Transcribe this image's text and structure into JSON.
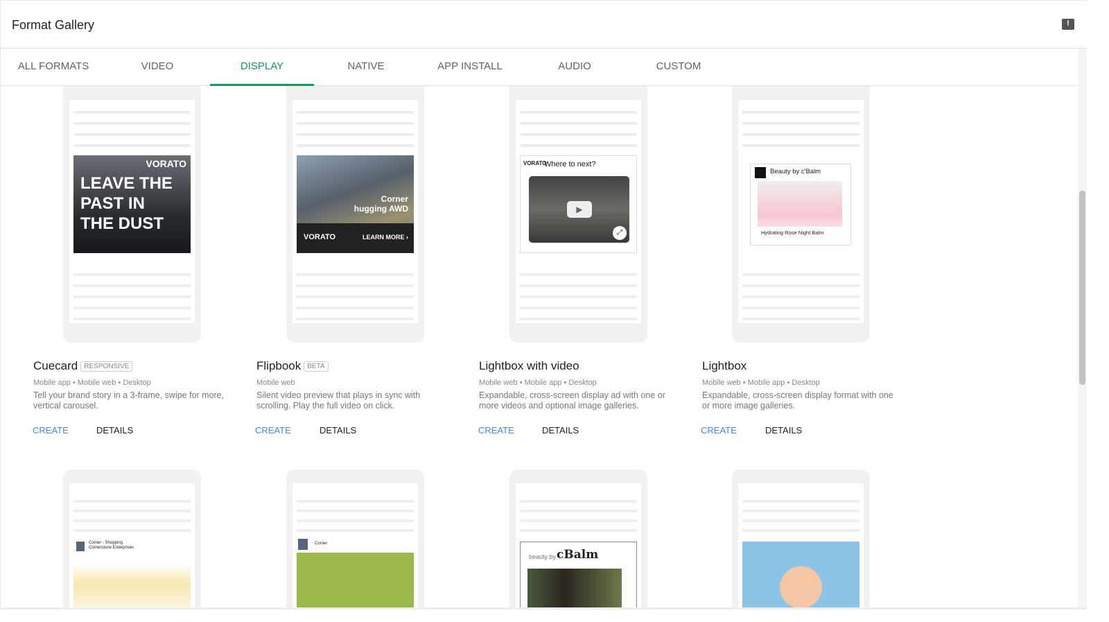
{
  "header": {
    "title": "Format Gallery",
    "feedback_icon": "feedback-icon"
  },
  "tabs": [
    {
      "label": "ALL FORMATS"
    },
    {
      "label": "VIDEO"
    },
    {
      "label": "DISPLAY",
      "active": true
    },
    {
      "label": "NATIVE"
    },
    {
      "label": "APP INSTALL"
    },
    {
      "label": "AUDIO"
    },
    {
      "label": "CUSTOM"
    }
  ],
  "cards": [
    {
      "title": "Cuecard",
      "badge": "RESPONSIVE",
      "platforms": "Mobile app • Mobile web • Desktop",
      "description": "Tell your brand story in a 3-frame, swipe for more, vertical carousel.",
      "create": "CREATE",
      "details": "DETAILS",
      "preview": {
        "brand": "VORATO",
        "headline": "LEAVE THE PAST IN THE DUST"
      }
    },
    {
      "title": "Flipbook",
      "badge": "BETA",
      "platforms": "Mobile web",
      "description": "Silent video preview that plays in sync with scrolling. Play the full video on click.",
      "create": "CREATE",
      "details": "DETAILS",
      "preview": {
        "brand": "VORATO",
        "tagline": "Corner hugging AWD",
        "cta": "LEARN MORE ›"
      }
    },
    {
      "title": "Lightbox with video",
      "platforms": "Mobile web • Mobile app • Desktop",
      "description": "Expandable, cross-screen display ad with one or more videos and optional image galleries.",
      "create": "CREATE",
      "details": "DETAILS",
      "preview": {
        "brand": "VORATO",
        "headline": "Where to next?"
      }
    },
    {
      "title": "Lightbox",
      "platforms": "Mobile web • Mobile app • Desktop",
      "description": "Expandable, cross-screen display format with one or more image galleries.",
      "create": "CREATE",
      "details": "DETAILS",
      "preview": {
        "brand": "Beauty by c'Balm",
        "caption": "Hydrating Rose Night Balm"
      }
    }
  ],
  "row2": [
    {
      "preview": {
        "app": "Corner - Shopping",
        "publisher": "Cornerstone Enterprises"
      }
    },
    {
      "preview": {
        "app": "Corner"
      }
    },
    {
      "preview": {
        "brand_small": "beauty by",
        "brand": "cBalm"
      }
    },
    {
      "preview": {}
    }
  ],
  "colors": {
    "accent": "#0f9d58",
    "link": "#4285f4"
  }
}
